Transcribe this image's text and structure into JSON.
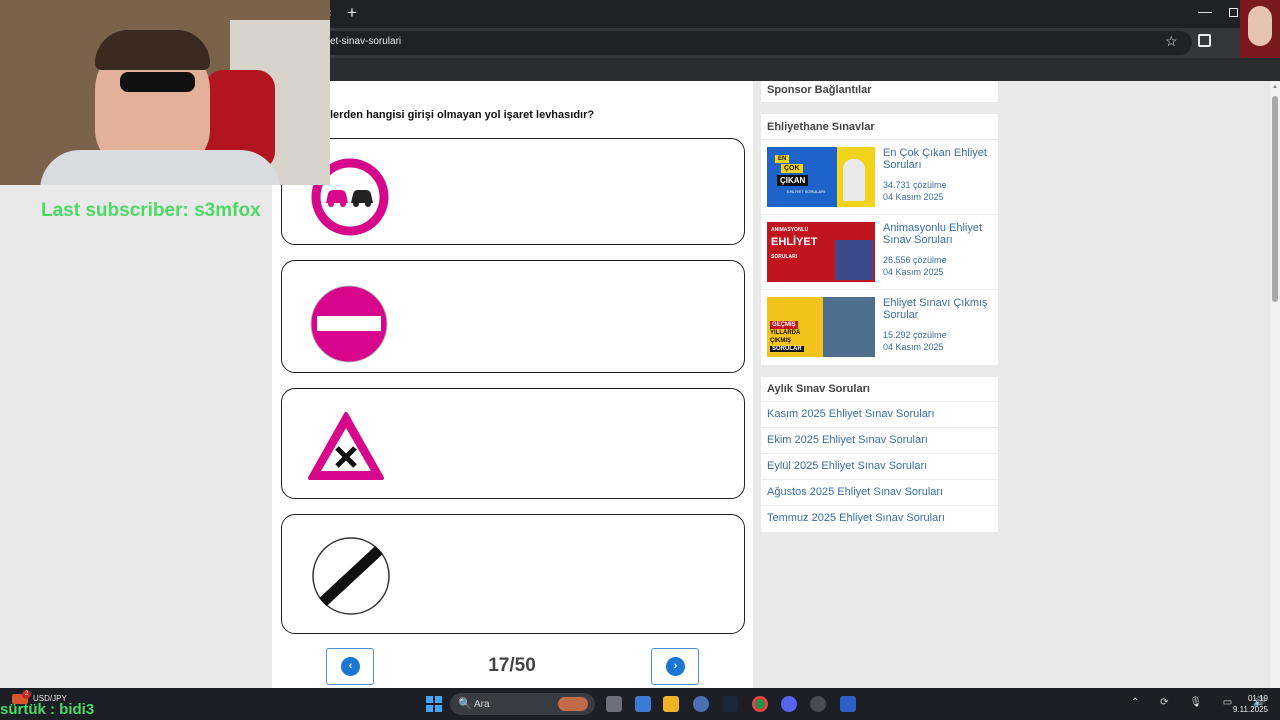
{
  "browser": {
    "tab_close": "×",
    "new_tab": "+",
    "url": "et-sinav-sorulari",
    "star": "☆",
    "minimize": "—"
  },
  "question": {
    "text": "lerden hangisi girişi olmayan yol işaret levhasıdır?",
    "options": [
      {
        "icon": "no-overtaking-sign-icon"
      },
      {
        "icon": "no-entry-sign-icon"
      },
      {
        "icon": "intersection-warning-sign-icon"
      },
      {
        "icon": "end-of-restrictions-sign-icon"
      }
    ]
  },
  "pagination": {
    "prev": "‹",
    "counter": "17/50",
    "next": "›"
  },
  "sidebar": {
    "sponsor_title": "Sponsor Bağlantılar",
    "exams_title": "Ehliyethane Sınavlar",
    "exams": [
      {
        "title": "En Çok Çıkan Ehliyet Soruları",
        "solves": "34.731 çözülme",
        "date": "04 Kasım 2025",
        "thumb": {
          "line1": "EN",
          "line2": "ÇOK",
          "line3": "ÇIKAN",
          "line4": "EHLİYET SORULARI"
        }
      },
      {
        "title": "Animasyonlu Ehliyet Sınav Soruları",
        "solves": "26.556 çözülme",
        "date": "04 Kasım 2025",
        "thumb": {
          "line1": "ANIMASYONLU",
          "line2": "EHLİYET",
          "line3": "SORULARI"
        }
      },
      {
        "title": "Ehliyet Sınavı Çıkmış Sorular",
        "solves": "15.292 çözülme",
        "date": "04 Kasım 2025",
        "thumb": {
          "line1": "GEÇMİŞ",
          "line2": "YILLARDA",
          "line3": "ÇIKMIŞ",
          "line4": "SORULAR"
        }
      }
    ],
    "monthly_title": "Aylık Sınav Soruları",
    "monthly": [
      "Kasım 2025 Ehliyet Sınav Soruları",
      "Ekim 2025 Ehliyet Sınav Soruları",
      "Eylül 2025 Ehliyet Sınav Soruları",
      "Ağustos 2025 Ehliyet Sınav Soruları",
      "Temmuz 2025 Ehliyet Sınav Soruları"
    ]
  },
  "overlay": {
    "last_subscriber": "Last subscriber: s3mfox",
    "surtuk": "sürtük : bidi3",
    "ticker_name": "USD/JPY",
    "ticker_badge": "2"
  },
  "taskbar": {
    "search_label": "Ara",
    "search_icon": "🔍",
    "time": "01:19",
    "date": "9.11.2025",
    "tray": "⌃ ⟳ 🎙 ▭ 🔊"
  },
  "colors": {
    "sign_pink": "#d6078a",
    "link_blue": "#3a6ea5",
    "button_blue": "#1976d2",
    "overlay_green": "#4cd964"
  }
}
